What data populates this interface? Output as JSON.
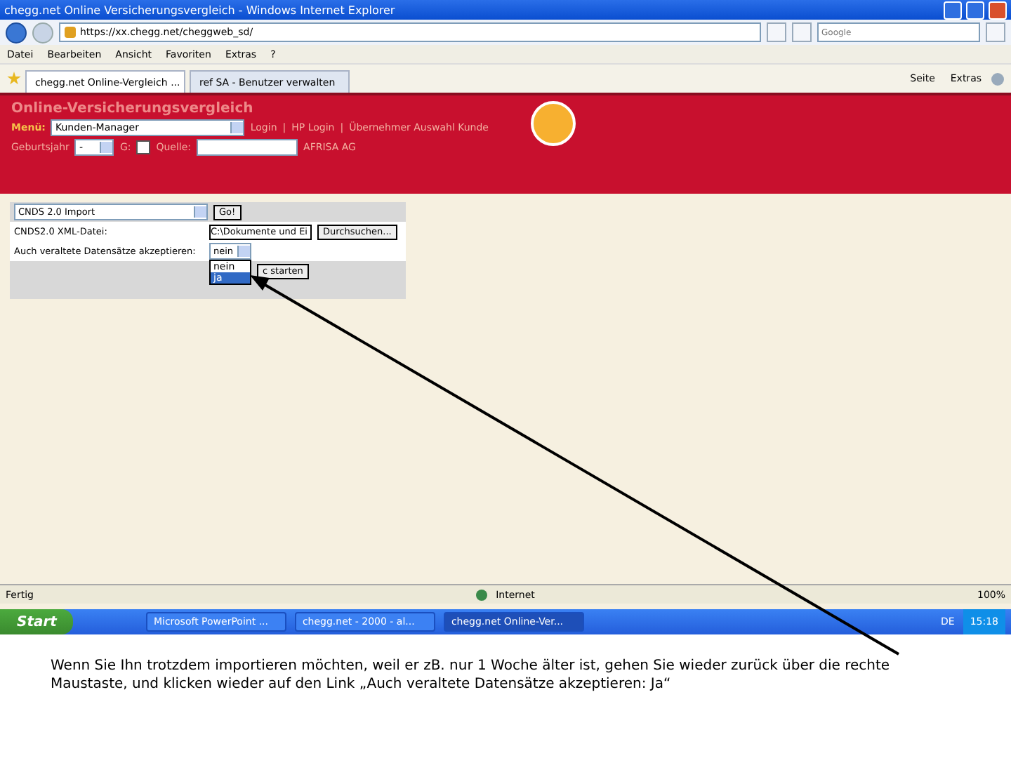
{
  "window": {
    "title": "chegg.net Online Versicherungsvergleich - Windows Internet Explorer"
  },
  "address_bar": {
    "url": "https://xx.chegg.net/cheggweb_sd/"
  },
  "search": {
    "placeholder": "Google"
  },
  "menu": [
    "Datei",
    "Bearbeiten",
    "Ansicht",
    "Favoriten",
    "Extras",
    "?"
  ],
  "tabs": [
    {
      "label": "chegg.net Online-Vergleich ...",
      "selected": true
    },
    {
      "label": "ref SA - Benutzer verwalten",
      "selected": false
    }
  ],
  "command_bar": [
    "Seite",
    "Extras"
  ],
  "page": {
    "heading": "Online-Versicherungsvergleich",
    "menu_label": "Menü:",
    "menu_select": "Kunden-Manager",
    "separator": "|",
    "links": [
      "Login",
      "HP Login",
      "Übernehmer Auswahl Kunde"
    ],
    "birth_label": "Geburtsjahr",
    "birth_select": "-",
    "g_label": "G:",
    "g_checked": false,
    "source_label": "Quelle:",
    "company": "AFRISA AG"
  },
  "form": {
    "import_select": "CNDS 2.0 Import",
    "go_button": "Go!",
    "file_label": "CNDS2.0 XML-Datei:",
    "file_value": "C:\\Dokumente und Ei",
    "browse_button": "Durchsuchen...",
    "outdated_label": "Auch veraltete Datensätze akzeptieren:",
    "outdated_select": "nein",
    "options": [
      {
        "label": "nein",
        "selected": false
      },
      {
        "label": "ja",
        "selected": true
      }
    ],
    "start_button": "c starten"
  },
  "status_bar": {
    "text": "Fertig",
    "zone": "Internet",
    "zoom": "100%"
  },
  "taskbar": {
    "start": "Start",
    "tasks": [
      {
        "label": "Microsoft PowerPoint ...",
        "selected": false
      },
      {
        "label": "chegg.net - 2000 - al...",
        "selected": false
      },
      {
        "label": "chegg.net Online-Ver...",
        "selected": true
      }
    ],
    "language": "DE",
    "clock": "15:18"
  },
  "caption": "Wenn Sie Ihn trotzdem importieren möchten, weil er zB. nur 1 Woche älter ist, gehen Sie wieder zurück über die rechte Maustaste, und klicken wieder auf den Link „Auch veraltete Datensätze akzeptieren: Ja“"
}
